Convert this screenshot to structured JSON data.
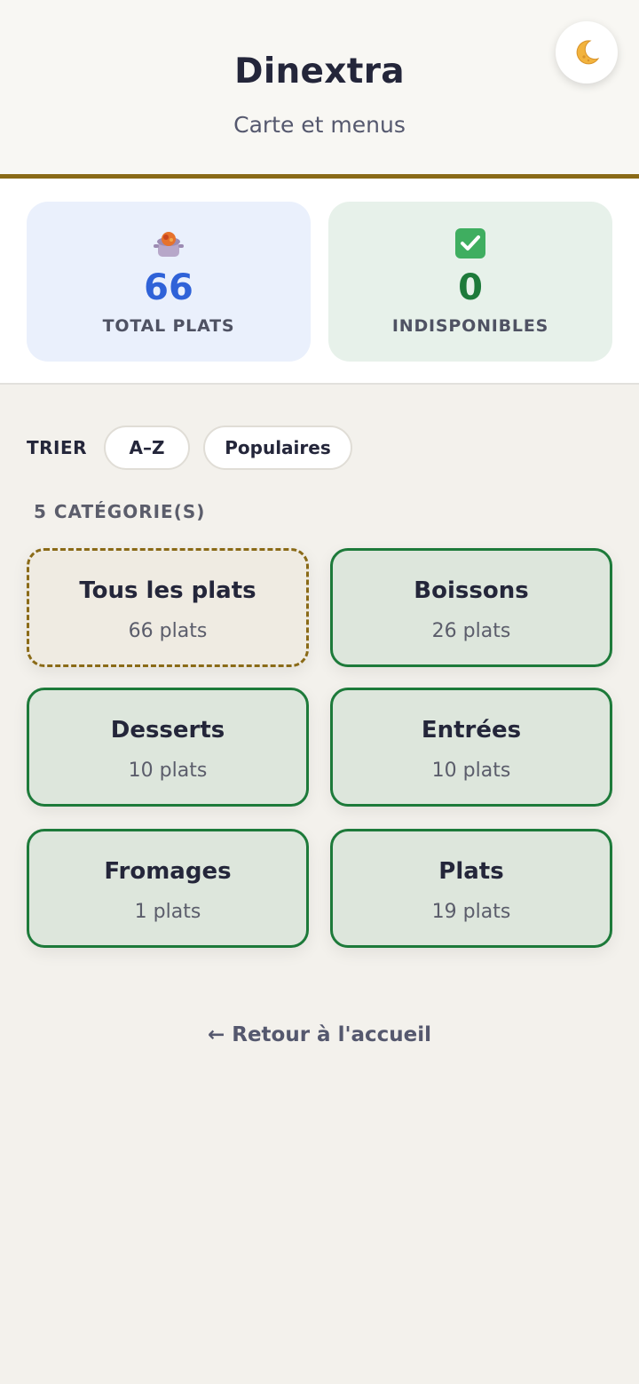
{
  "header": {
    "title": "Dinextra",
    "subtitle": "Carte et menus",
    "theme_toggle_icon": "moon-icon"
  },
  "stats": {
    "total": {
      "icon": "cooking-pot-icon",
      "value": "66",
      "label": "TOTAL PLATS",
      "color": "#2f62d8"
    },
    "unavailable": {
      "icon": "check-box-icon",
      "value": "0",
      "label": "INDISPONIBLES",
      "color": "#1d7a3a"
    }
  },
  "sort": {
    "label": "TRIER",
    "options": [
      "A–Z",
      "Populaires"
    ]
  },
  "categories": {
    "count_label": "5 CATÉGORIE(S)",
    "items": [
      {
        "name": "Tous les plats",
        "count": "66 plats",
        "selected": true
      },
      {
        "name": "Boissons",
        "count": "26 plats",
        "selected": false
      },
      {
        "name": "Desserts",
        "count": "10 plats",
        "selected": false
      },
      {
        "name": "Entrées",
        "count": "10 plats",
        "selected": false
      },
      {
        "name": "Fromages",
        "count": "1 plats",
        "selected": false
      },
      {
        "name": "Plats",
        "count": "19 plats",
        "selected": false
      }
    ]
  },
  "footer": {
    "back_link": "← Retour à l'accueil"
  },
  "colors": {
    "accent_gold": "#8a6a17",
    "accent_green": "#1d7a3a",
    "accent_blue": "#2f62d8"
  }
}
